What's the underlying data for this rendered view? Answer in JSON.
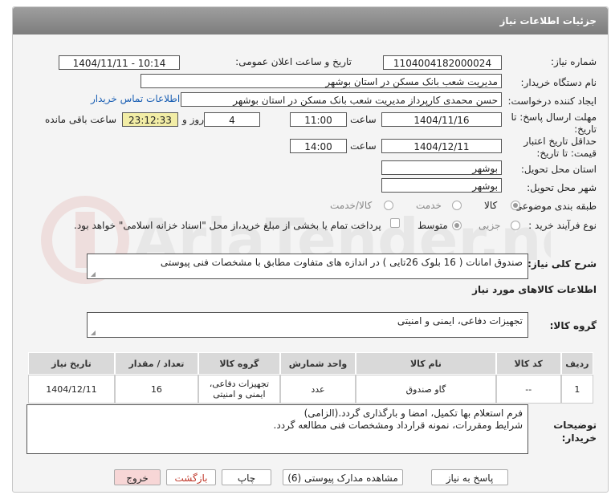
{
  "header_title": "جزئیات اطلاعات نیاز",
  "labels": {
    "need_number": "شماره نیاز:",
    "announce_datetime": "تاریخ و ساعت اعلان عمومی:",
    "buyer_org": "نام دستگاه خریدار:",
    "requester": "ایجاد کننده درخواست:",
    "reply_deadline": "مهلت ارسال پاسخ: تا تاریخ:",
    "time_word": "ساعت",
    "days_and": "روز و",
    "remaining": "ساعت باقی مانده",
    "price_validity": "حداقل تاریخ اعتبار قیمت: تا تاریخ:",
    "delivery_province": "استان محل تحویل:",
    "delivery_city": "شهر محل تحویل:",
    "subject_class": "طبقه بندی موضوعی:",
    "process_type": "نوع فرآیند خرید :",
    "general_desc": "شرح کلی نیاز:",
    "goods_info": "اطلاعات کالاهای مورد نیاز",
    "goods_group": "گروه کالا:",
    "buyer_notes": "توضیحات خریدار:"
  },
  "values": {
    "need_number": "1104004182000024",
    "announce_datetime": "1404/11/11 - 10:14",
    "buyer_org": "مدیریت شعب بانک مسکن در استان بوشهر",
    "requester": "حسن محمدی کارپرداز مدیریت شعب بانک مسکن در استان بوشهر",
    "contact_link": "اطلاعات تماس خریدار",
    "reply_date": "1404/11/16",
    "reply_time": "11:00",
    "days": "4",
    "countdown": "23:12:33",
    "validity_date": "1404/12/11",
    "validity_time": "14:00",
    "province": "بوشهر",
    "city": "بوشهر",
    "general_desc": "صندوق امانات ( 16 بلوک 26تایی ) در اندازه های متفاوت مطابق با مشخصات فنی پیوستی",
    "goods_group": "تجهیزات دفاعی، ایمنی و امنیتی",
    "buyer_notes_line1": "فرم استعلام بها تکمیل، امضا و بارگذاری گردد.(الزامی)",
    "buyer_notes_line2": "شرایط ومقررات، نمونه قرارداد ومشخصات فنی مطالعه گردد."
  },
  "subject_options": {
    "goods": "کالا",
    "service": "خدمت",
    "goods_service": "کالا/خدمت",
    "selected": "کالا"
  },
  "process_options": {
    "partial": "جزیی",
    "medium": "متوسط",
    "selected": "متوسط",
    "payment_note": "پرداخت تمام یا بخشی از مبلغ خرید،از محل \"اسناد خزانه اسلامی\" خواهد بود."
  },
  "table": {
    "headers": [
      "ردیف",
      "کد کالا",
      "نام کالا",
      "واحد شمارش",
      "گروه کالا",
      "تعداد / مقدار",
      "تاریخ نیاز"
    ],
    "rows": [
      [
        "1",
        "--",
        "گاو صندوق",
        "عدد",
        "تجهیزات دفاعی، ایمنی و امنیتی",
        "16",
        "1404/12/11"
      ]
    ]
  },
  "buttons": {
    "reply": "پاسخ به نیاز",
    "attachments": "مشاهده مدارک پیوستی (6)",
    "print": "چاپ",
    "back": "بازگشت",
    "exit": "خروج"
  },
  "watermark_text": "AriaTender.neT",
  "colors": {
    "header_bg": "#8c8c8c",
    "timer_bg": "#f2eda6",
    "link": "#1a5fb4",
    "exit_bg": "#f7d6d6",
    "watermark": "#c0392b"
  }
}
